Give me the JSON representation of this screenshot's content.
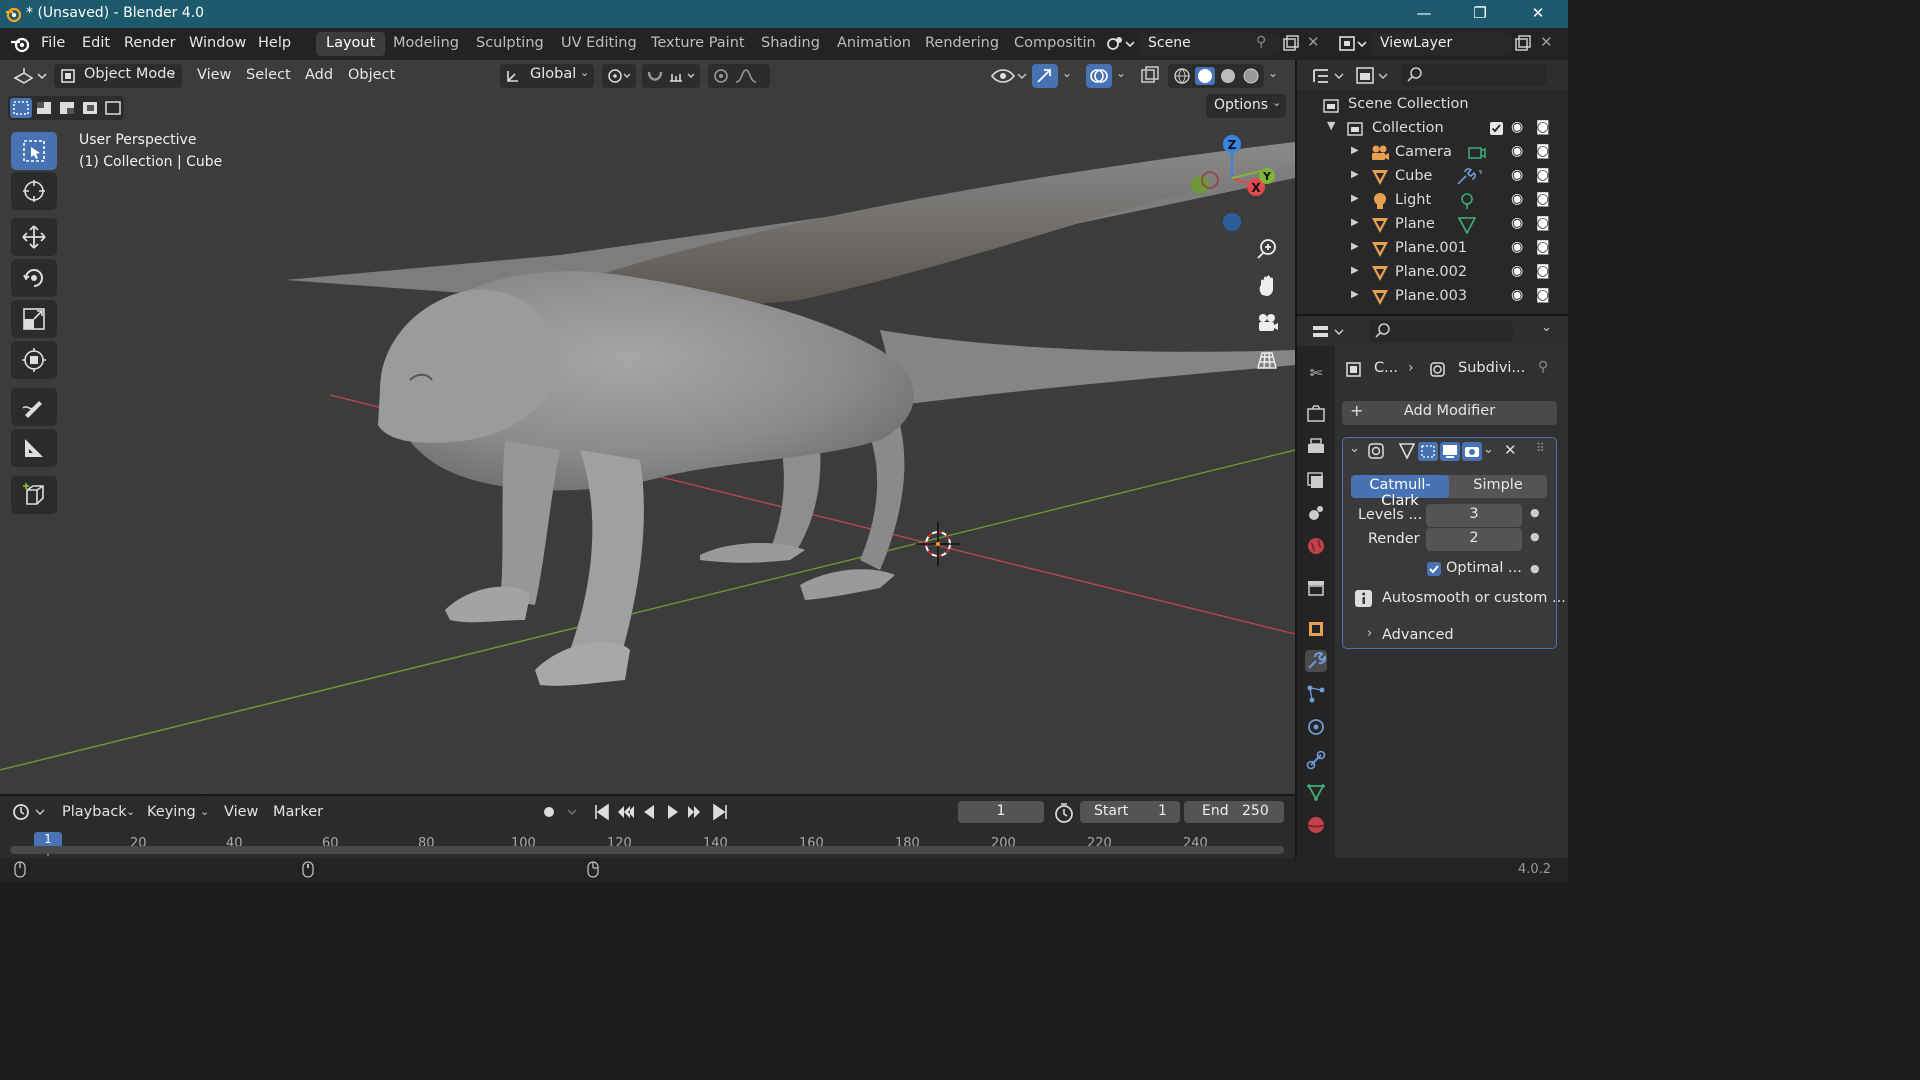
{
  "window": {
    "title": "* (Unsaved) - Blender 4.0",
    "minimize": "—",
    "maximize": "❐",
    "close": "✕"
  },
  "menu": {
    "items": [
      "File",
      "Edit",
      "Render",
      "Window",
      "Help"
    ]
  },
  "workspaces": {
    "tabs": [
      "Layout",
      "Modeling",
      "Sculpting",
      "UV Editing",
      "Texture Paint",
      "Shading",
      "Animation",
      "Rendering",
      "Compositin"
    ],
    "active": "Layout"
  },
  "scene": {
    "label": "Scene"
  },
  "viewlayer": {
    "label": "ViewLayer"
  },
  "viewport_header": {
    "mode": "Object Mode",
    "menus": [
      "View",
      "Select",
      "Add",
      "Object"
    ],
    "transform_orientation": "Global",
    "options": "Options"
  },
  "viewport_overlay": {
    "perspective": "User Perspective",
    "context": "(1) Collection | Cube"
  },
  "gizmo": {
    "z": "Z",
    "x": "X",
    "y": "Y"
  },
  "outliner": {
    "root": "Scene Collection",
    "collection": "Collection",
    "items": [
      {
        "name": "Camera",
        "icon": "camera-icon",
        "color": "#e8a050"
      },
      {
        "name": "Cube",
        "icon": "mesh-icon",
        "color": "#e8a050"
      },
      {
        "name": "Light",
        "icon": "light-icon",
        "color": "#e8a050"
      },
      {
        "name": "Plane",
        "icon": "mesh-icon",
        "color": "#e8a050"
      },
      {
        "name": "Plane.001",
        "icon": "mesh-icon",
        "color": "#e8a050"
      },
      {
        "name": "Plane.002",
        "icon": "mesh-icon",
        "color": "#e8a050"
      },
      {
        "name": "Plane.003",
        "icon": "mesh-icon",
        "color": "#e8a050"
      }
    ]
  },
  "properties": {
    "breadcrumb_object": "C...",
    "breadcrumb_modifier": "Subdivi...",
    "add_modifier": "Add Modifier",
    "modifier": {
      "type_catmull": "Catmull-Clark",
      "type_simple": "Simple",
      "levels_label": "Levels ...",
      "levels_value": "3",
      "render_label": "Render",
      "render_value": "2",
      "optimal_label": "Optimal ...",
      "optimal_checked": true,
      "info": "Autosmooth or custom ...",
      "advanced": "Advanced"
    }
  },
  "timeline": {
    "menus": [
      "Playback",
      "Keying",
      "View",
      "Marker"
    ],
    "current_frame": "1",
    "start_label": "Start",
    "start_value": "1",
    "end_label": "End",
    "end_value": "250",
    "ticks": [
      "20",
      "40",
      "60",
      "80",
      "100",
      "120",
      "140",
      "160",
      "180",
      "200",
      "220",
      "240"
    ],
    "frame_marker": "1"
  },
  "status": {
    "version": "4.0.2"
  },
  "colors": {
    "titlebar": "#1e5a6e",
    "accent": "#4772b3",
    "x_axis": "#e0484f",
    "y_axis": "#7fb637",
    "z_axis": "#3a83e0"
  }
}
